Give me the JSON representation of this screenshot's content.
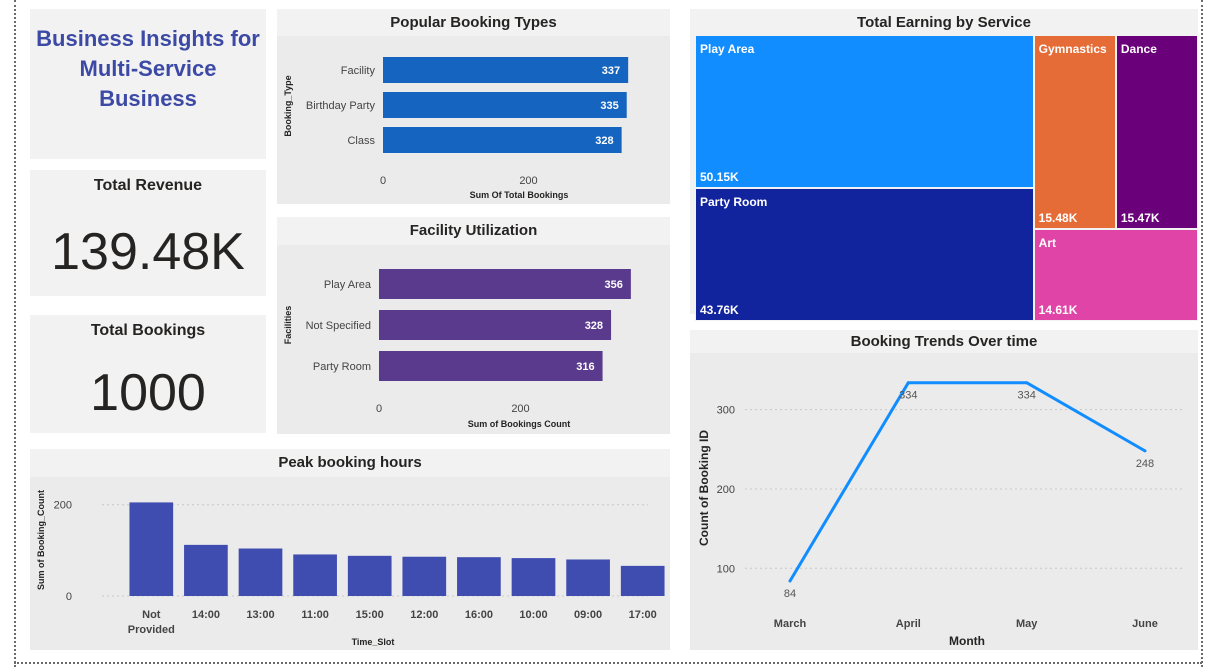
{
  "header": {
    "title_line1": "Business Insights for",
    "title_line2": "Multi-Service",
    "title_line3": "Business"
  },
  "kpis": {
    "revenue_label": "Total Revenue",
    "revenue_value": "139.48K",
    "bookings_label": "Total Bookings",
    "bookings_value": "1000"
  },
  "colors": {
    "title_blue": "#3c4aa6",
    "booking_bar": "#1565c0",
    "facility_bar": "#5a3a8c",
    "peak_bar": "#3f4cb0",
    "trend_line": "#118dff"
  },
  "chart_data": [
    {
      "id": "popular",
      "type": "bar",
      "orientation": "horizontal",
      "title": "Popular Booking Types",
      "categories": [
        "Facility",
        "Birthday Party",
        "Class"
      ],
      "values": [
        337,
        335,
        328
      ],
      "value_labels": [
        "337",
        "335",
        "328"
      ],
      "xlabel": "Sum Of Total Bookings",
      "ylabel": "Booking_Type",
      "xticks": [
        0,
        200
      ],
      "xlim": [
        0,
        400
      ]
    },
    {
      "id": "facility",
      "type": "bar",
      "orientation": "horizontal",
      "title": "Facility Utilization",
      "categories": [
        "Play Area",
        "Not Specified",
        "Party Room"
      ],
      "values": [
        356,
        328,
        316
      ],
      "value_labels": [
        "356",
        "328",
        "316"
      ],
      "xlabel": "Sum of Bookings Count",
      "ylabel": "Facilities",
      "xticks": [
        0,
        200
      ],
      "xlim": [
        0,
        400
      ]
    },
    {
      "id": "peak",
      "type": "bar",
      "title": "Peak booking hours",
      "categories": [
        [
          "Not",
          "Provided"
        ],
        [
          "14:00"
        ],
        [
          "13:00"
        ],
        [
          "11:00"
        ],
        [
          "15:00"
        ],
        [
          "12:00"
        ],
        [
          "16:00"
        ],
        [
          "10:00"
        ],
        [
          "09:00"
        ],
        [
          "17:00"
        ]
      ],
      "values": [
        205,
        112,
        104,
        91,
        88,
        86,
        85,
        83,
        80,
        66
      ],
      "xlabel": "Time_Slot",
      "ylabel": "Sum of Booking_Count",
      "yticks": [
        0,
        200
      ],
      "ylim": [
        0,
        230
      ],
      "grid": true
    },
    {
      "id": "treemap",
      "type": "treemap",
      "title": "Total Earning by Service",
      "items": [
        {
          "name": "Play Area",
          "value": 50.15,
          "label": "50.15K",
          "color": "#118dff"
        },
        {
          "name": "Party Room",
          "value": 43.76,
          "label": "43.76K",
          "color": "#12239e"
        },
        {
          "name": "Gymnastics",
          "value": 15.48,
          "label": "15.48K",
          "color": "#e66c37"
        },
        {
          "name": "Dance",
          "value": 15.47,
          "label": "15.47K",
          "color": "#6b007b"
        },
        {
          "name": "Art",
          "value": 14.61,
          "label": "14.61K",
          "color": "#e044a7"
        }
      ]
    },
    {
      "id": "trend",
      "type": "line",
      "title": "Booking Trends Over time",
      "x": [
        "March",
        "April",
        "May",
        "June"
      ],
      "values": [
        84,
        334,
        334,
        248
      ],
      "value_labels": [
        "84",
        "334",
        "334",
        "248"
      ],
      "xlabel": "Month",
      "ylabel": "Count of Booking ID",
      "yticks": [
        100,
        200,
        300
      ],
      "ylim": [
        60,
        350
      ],
      "grid": true
    }
  ]
}
